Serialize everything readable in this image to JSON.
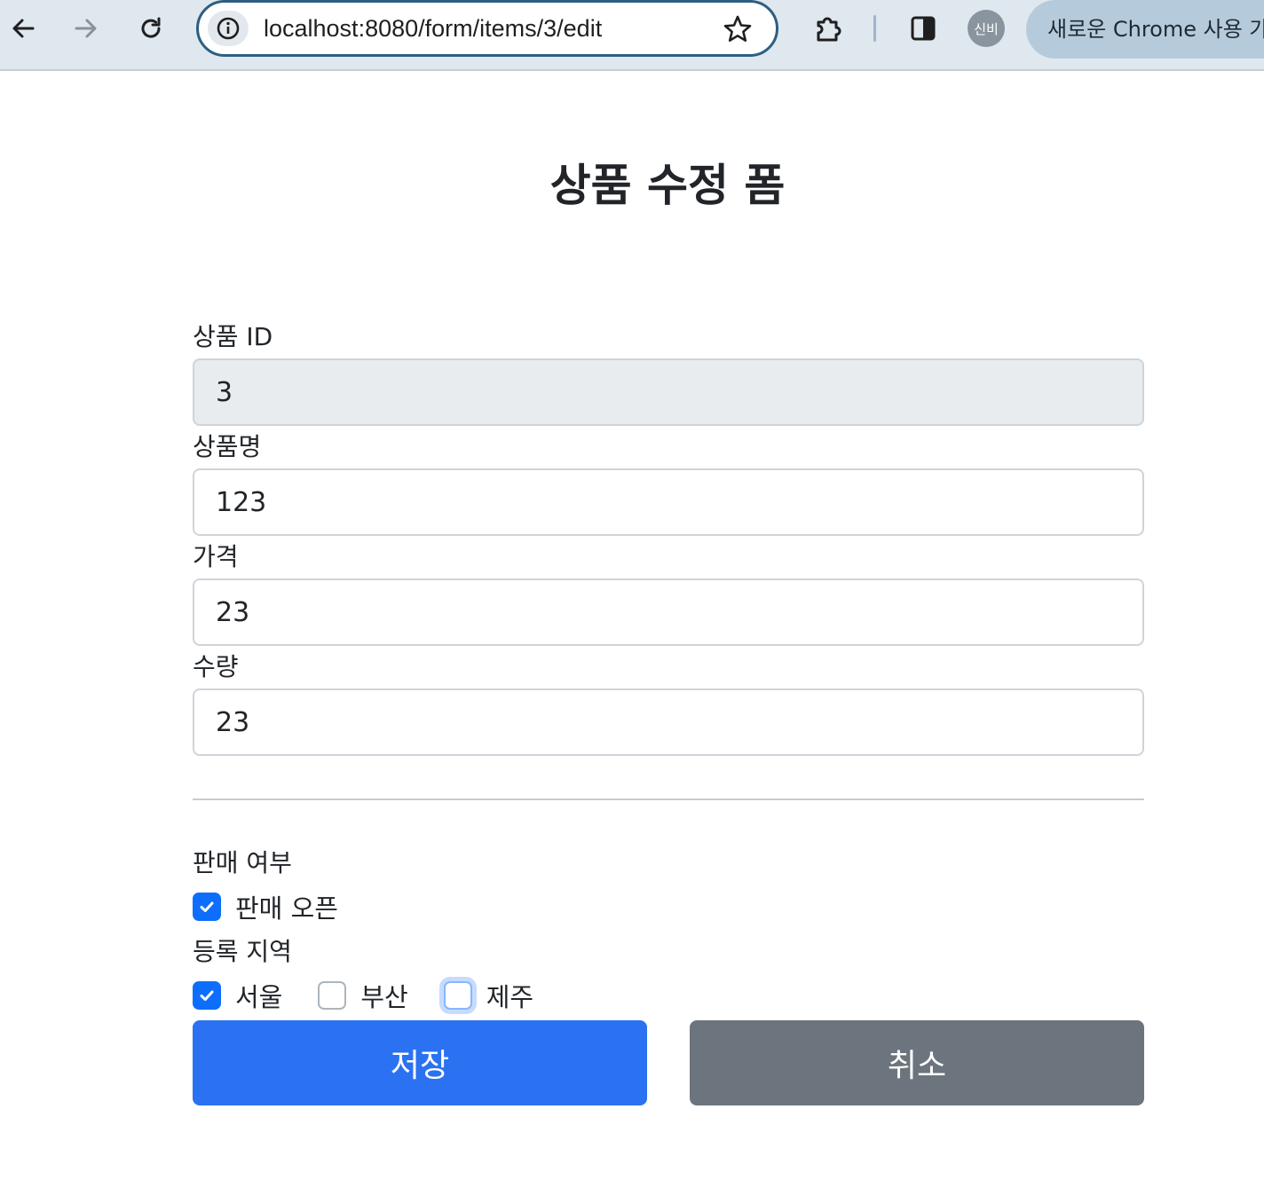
{
  "browser": {
    "url": "localhost:8080/form/items/3/edit",
    "avatar_text": "신비",
    "profile_chip_text": "새로운 Chrome 사용 가",
    "toolbar_color": "#dfe7ef"
  },
  "page": {
    "title": "상품 수정 폼"
  },
  "form": {
    "id": {
      "label": "상품 ID",
      "value": "3"
    },
    "name": {
      "label": "상품명",
      "value": "123"
    },
    "price": {
      "label": "가격",
      "value": "23"
    },
    "quantity": {
      "label": "수량",
      "value": "23"
    }
  },
  "sale": {
    "label": "판매 여부",
    "open_label": "판매 오픈",
    "open_checked": true
  },
  "regions": {
    "label": "등록 지역",
    "items": [
      {
        "label": "서울",
        "checked": true
      },
      {
        "label": "부산",
        "checked": false
      },
      {
        "label": "제주",
        "checked": false
      }
    ]
  },
  "buttons": {
    "save": "저장",
    "cancel": "취소"
  },
  "colors": {
    "primary": "#2a72f1",
    "secondary": "#6c757d",
    "checkbox_checked": "#0d6efd"
  },
  "icons": [
    "back-arrow-icon",
    "forward-arrow-icon",
    "reload-icon",
    "site-info-icon",
    "bookmark-star-icon",
    "extensions-icon",
    "side-panel-icon",
    "checkmark-icon"
  ]
}
